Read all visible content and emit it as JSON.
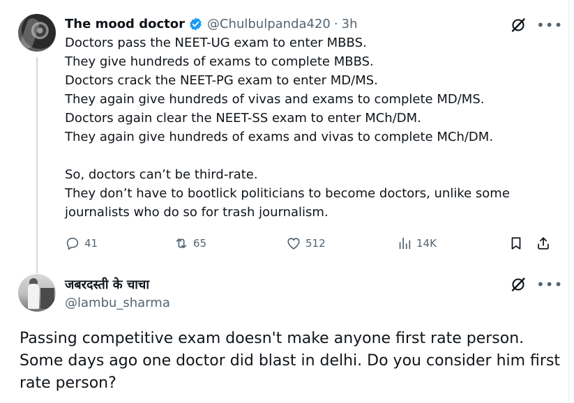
{
  "tweet": {
    "author": {
      "display_name": "The mood doctor",
      "handle": "@Chulbulpanda420",
      "verified": true,
      "separator": "·",
      "time": "3h"
    },
    "text_lines": [
      "Doctors pass the NEET-UG exam to enter MBBS.",
      "They give hundreds of exams to complete MBBS.",
      "Doctors crack the NEET-PG exam to enter MD/MS.",
      "They again give hundreds of vivas and exams to complete MD/MS.",
      "Doctors again clear the NEET-SS exam to enter MCh/DM.",
      "They again give hundreds of exams and vivas to complete MCh/DM.",
      "",
      "So, doctors can’t be third-rate.",
      "They don’t have to bootlick politicians to become doctors, unlike some",
      "journalists who do so for trash journalism."
    ],
    "stats": {
      "replies": "41",
      "reposts": "65",
      "likes": "512",
      "views": "14K"
    },
    "icons": [
      "grok-icon",
      "more-icon",
      "reply-icon",
      "repost-icon",
      "like-icon",
      "views-icon",
      "bookmark-icon",
      "share-icon"
    ]
  },
  "reply": {
    "author": {
      "display_name": "जबरदस्ती के चाचा",
      "handle": "@lambu_sharma"
    },
    "text_lines": [
      "Passing competitive exam doesn't make anyone first rate person.",
      "Some days ago one doctor did blast in delhi. Do you consider him first",
      "rate person?"
    ]
  },
  "colors": {
    "text": "#0f1419",
    "secondary": "#536471",
    "verified": "#1d9bf0",
    "thread_line": "#cfd9de"
  }
}
